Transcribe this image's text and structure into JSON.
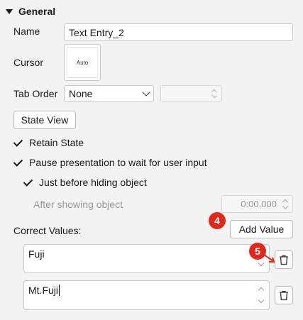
{
  "section": {
    "title": "General"
  },
  "name_field": {
    "label": "Name",
    "value": "Text Entry_2"
  },
  "cursor_field": {
    "label": "Cursor",
    "preview": "Auto"
  },
  "tab_order": {
    "label": "Tab Order",
    "selected": "None",
    "number_value": ""
  },
  "state_view_button": "State View",
  "retain_state": {
    "label": "Retain State",
    "checked": true
  },
  "pause_presentation": {
    "label": "Pause presentation to wait for user input",
    "checked": true
  },
  "just_before_hiding": {
    "label": "Just before hiding object",
    "checked": true
  },
  "after_showing": {
    "label": "After showing object",
    "value": "0:00,000"
  },
  "correct_values": {
    "label": "Correct Values:",
    "add_button": "Add Value",
    "items": [
      {
        "value": "Fuji"
      },
      {
        "value": "Mt.Fuji"
      }
    ]
  },
  "annotations": {
    "badge_4": "4",
    "badge_5": "5",
    "badge_color": "#e0281d"
  }
}
